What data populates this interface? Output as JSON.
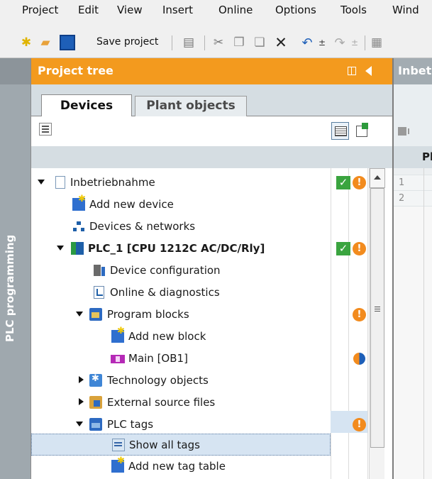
{
  "menu": [
    "Project",
    "Edit",
    "View",
    "Insert",
    "Online",
    "Options",
    "Tools",
    "Wind"
  ],
  "toolbar": {
    "save_label": "Save project"
  },
  "side_strip": {
    "label": "PLC programming"
  },
  "project_tree": {
    "title": "Project tree",
    "tabs": [
      {
        "label": "Devices",
        "active": true
      },
      {
        "label": "Plant objects",
        "active": false
      }
    ]
  },
  "tree": [
    {
      "label": "Inbetriebnahme",
      "icon": "project-icon",
      "expanded": true,
      "status": [
        "ok",
        "warning"
      ]
    },
    {
      "label": "Add new device",
      "icon": "add-device-icon"
    },
    {
      "label": "Devices & networks",
      "icon": "network-icon"
    },
    {
      "label": "PLC_1 [CPU 1212C AC/DC/Rly]",
      "icon": "plc-icon",
      "expanded": true,
      "bold": true,
      "status": [
        "ok",
        "warning"
      ]
    },
    {
      "label": "Device configuration",
      "icon": "device-config-icon"
    },
    {
      "label": "Online & diagnostics",
      "icon": "diagnostics-icon"
    },
    {
      "label": "Program blocks",
      "icon": "folder-icon",
      "expanded": true,
      "status": [
        "warning"
      ]
    },
    {
      "label": "Add new block",
      "icon": "add-block-icon"
    },
    {
      "label": "Main [OB1]",
      "icon": "ob-icon",
      "status": [
        "partial"
      ]
    },
    {
      "label": "Technology objects",
      "icon": "technology-icon",
      "expanded": false
    },
    {
      "label": "External source files",
      "icon": "external-files-icon",
      "expanded": false
    },
    {
      "label": "PLC tags",
      "icon": "tags-folder-icon",
      "expanded": true,
      "status": [
        "warning"
      ]
    },
    {
      "label": "Show all tags",
      "icon": "show-tags-icon",
      "selected": true
    },
    {
      "label": "Add new tag table",
      "icon": "add-tag-table-icon"
    }
  ],
  "right_panel": {
    "title": "Inbet",
    "column_header": "Pl",
    "rows": [
      "1",
      "2"
    ]
  },
  "colors": {
    "header_orange": "#f39a1e",
    "selection": "#d6e4f2",
    "ok_green": "#3aa43f",
    "warning_orange": "#f28b1e"
  }
}
